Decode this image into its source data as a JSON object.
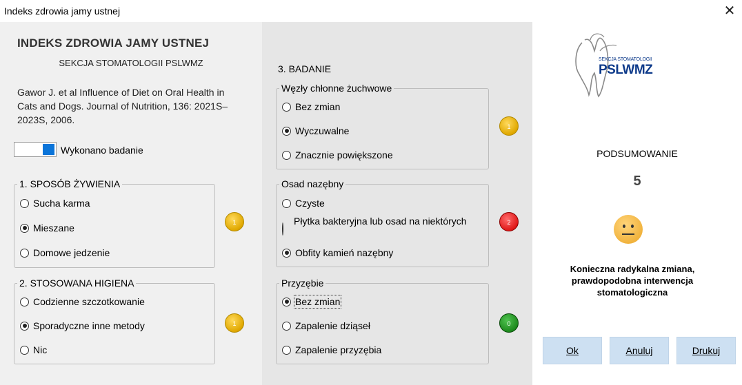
{
  "window": {
    "title": "Indeks zdrowia jamy ustnej"
  },
  "left": {
    "heading": "INDEKS ZDROWIA JAMY USTNEJ",
    "subheading": "SEKCJA STOMATOLOGII PSLWMZ",
    "citation": "Gawor J. et al Influence of Diet on Oral Health in Cats and Dogs. Journal of Nutrition, 136: 2021S–2023S, 2006.",
    "toggle_label": "Wykonano badanie",
    "group1": {
      "legend": "1. SPOSÓB ŻYWIENIA",
      "options": [
        "Sucha karma",
        "Mieszane",
        "Domowe jedzenie"
      ],
      "selected": 1,
      "score": "1"
    },
    "group2": {
      "legend": "2. STOSOWANA HIGIENA",
      "options": [
        "Codzienne szczotkowanie",
        "Sporadyczne inne metody",
        "Nic"
      ],
      "selected": 1,
      "score": "1"
    }
  },
  "middle": {
    "section_title": "3. BADANIE",
    "group1": {
      "legend": "Węzły chłonne żuchwowe",
      "options": [
        "Bez zmian",
        "Wyczuwalne",
        "Znacznie powiększone"
      ],
      "selected": 1,
      "score": "1"
    },
    "group2": {
      "legend": "Osad nazębny",
      "options": [
        "Czyste",
        "Płytka bakteryjna lub osad na niektórych",
        "Obfity kamień nazębny"
      ],
      "selected": 2,
      "score": "2"
    },
    "group3": {
      "legend": "Przyzębie",
      "options": [
        "Bez zmian",
        "Zapalenie dziąseł",
        "Zapalenie przyzębia"
      ],
      "selected": 0,
      "score": "0"
    }
  },
  "right": {
    "logo_text_small": "SEKCJA STOMATOLOGII",
    "logo_text_big": "PSLWMZ",
    "summary_label": "PODSUMOWANIE",
    "summary_value": "5",
    "message_line1": "Konieczna radykalna zmiana,",
    "message_line2": "prawdopodobna interwencja",
    "message_line3": "stomatologiczna",
    "buttons": {
      "ok": "Ok",
      "cancel": "Anuluj",
      "print": "Drukuj"
    }
  },
  "colors": {
    "accent": "#0a74d9",
    "button_bg": "#cde0f2",
    "logo_blue": "#0d3a8a"
  }
}
